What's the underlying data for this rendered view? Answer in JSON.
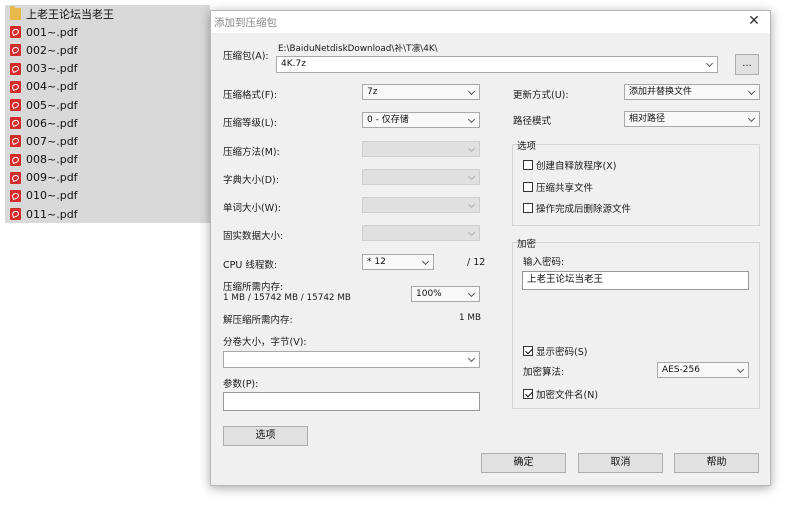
{
  "file_list": {
    "folder": "上老王论坛当老王",
    "files": [
      "001~.pdf",
      "002~.pdf",
      "003~.pdf",
      "004~.pdf",
      "005~.pdf",
      "006~.pdf",
      "007~.pdf",
      "008~.pdf",
      "009~.pdf",
      "010~.pdf",
      "011~.pdf"
    ]
  },
  "dialog": {
    "title": "添加到压缩包",
    "close_glyph": "✕",
    "archive": {
      "label": "压缩包(A):",
      "path": "E:\\BaiduNetdiskDownload\\补\\T凛\\4K\\",
      "name": "4K.7z",
      "browse_label": "..."
    },
    "format": {
      "label": "压缩格式(F):",
      "value": "7z"
    },
    "level": {
      "label": "压缩等级(L):",
      "value": "0 - 仅存储"
    },
    "method": {
      "label": "压缩方法(M):",
      "value": ""
    },
    "dict_size": {
      "label": "字典大小(D):",
      "value": ""
    },
    "word_size": {
      "label": "单词大小(W):",
      "value": ""
    },
    "solid_size": {
      "label": "固实数据大小:",
      "value": ""
    },
    "threads": {
      "label": "CPU 线程数:",
      "value": "* 12",
      "max": "/ 12"
    },
    "memory_compress": {
      "label": "压缩所需内存:",
      "detail": "1 MB / 15742 MB / 15742 MB",
      "value": "100%"
    },
    "memory_decompress": {
      "label": "解压缩所需内存:",
      "value": "1 MB"
    },
    "split": {
      "label": "分卷大小，字节(V):",
      "value": ""
    },
    "params": {
      "label": "参数(P):",
      "value": ""
    },
    "options_button": "选项",
    "update_mode": {
      "label": "更新方式(U):",
      "value": "添加并替换文件"
    },
    "path_mode": {
      "label": "路径模式",
      "value": "相对路径"
    },
    "options_group": {
      "title": "选项",
      "sfx": "创建自释放程序(X)",
      "shared": "压缩共享文件",
      "delete_after": "操作完成后删除源文件"
    },
    "encryption": {
      "title": "加密",
      "password_label": "输入密码:",
      "password_value": "上老王论坛当老王",
      "show_password": "显示密码(S)",
      "method_label": "加密算法:",
      "method_value": "AES-256",
      "encrypt_names": "加密文件名(N)"
    },
    "buttons": {
      "ok": "确定",
      "cancel": "取消",
      "help": "帮助"
    }
  }
}
